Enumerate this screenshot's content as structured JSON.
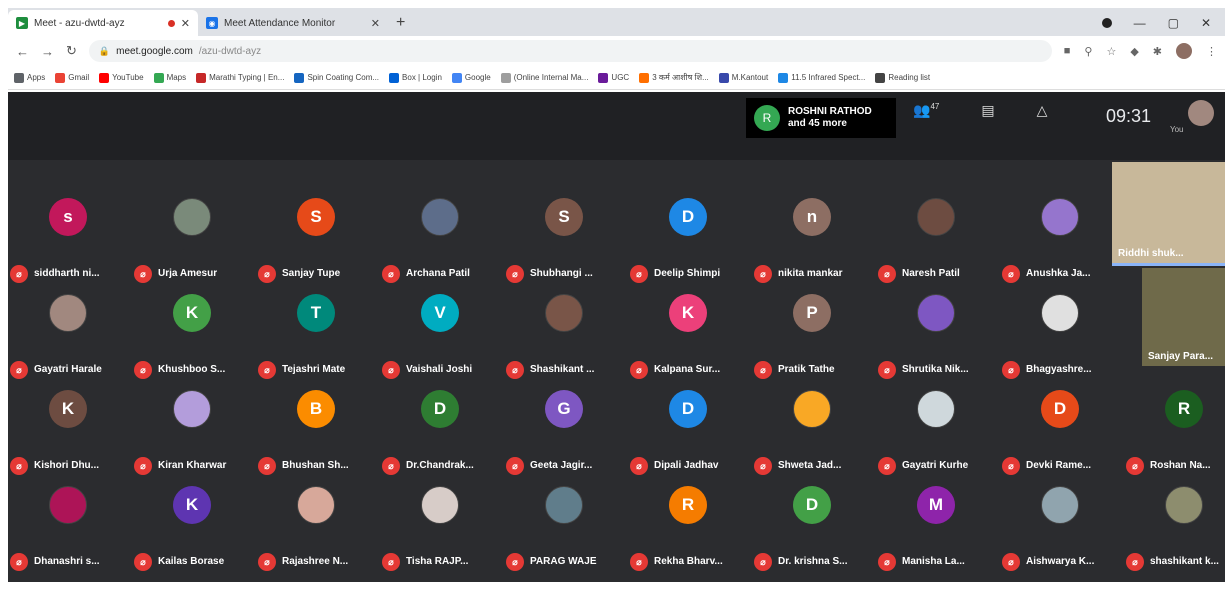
{
  "browser": {
    "tabs": [
      {
        "title": "Meet - azu-dwtd-ayz",
        "fav_color": "#1e8e3e",
        "active": true,
        "recording": true
      },
      {
        "title": "Meet Attendance Monitor",
        "fav_color": "#1a73e8",
        "active": false,
        "recording": false
      }
    ],
    "new_tab": "+",
    "url_host": "meet.google.com",
    "url_path": "/azu-dwtd-ayz",
    "bookmarks": [
      {
        "label": "Apps",
        "color": "#5f6368"
      },
      {
        "label": "Gmail",
        "color": "#ea4335"
      },
      {
        "label": "YouTube",
        "color": "#ff0000"
      },
      {
        "label": "Maps",
        "color": "#34a853"
      },
      {
        "label": "Marathi Typing | En...",
        "color": "#c62828"
      },
      {
        "label": "Spin Coating Com...",
        "color": "#1565c0"
      },
      {
        "label": "Box | Login",
        "color": "#0061d5"
      },
      {
        "label": "Google",
        "color": "#4285f4"
      },
      {
        "label": "(Online Internal Ma...",
        "color": "#9e9e9e"
      },
      {
        "label": "UGC",
        "color": "#6a1b9a"
      },
      {
        "label": "3 कर्म आशीष शि...",
        "color": "#ff6f00"
      },
      {
        "label": "M.Kantout",
        "color": "#3949ab"
      },
      {
        "label": "11.5 Infrared Spect...",
        "color": "#1e88e5"
      },
      {
        "label": "Reading list",
        "color": "#444"
      }
    ]
  },
  "meet": {
    "joined": {
      "initial": "R",
      "name": "ROSHNI RATHOD",
      "more": "and 45 more"
    },
    "participant_count": "47",
    "time": "09:31",
    "self_label": "You",
    "tiles": [
      {
        "name": "siddharth ni...",
        "initial": "s",
        "color": "#c2185b"
      },
      {
        "name": "Urja Amesur",
        "initial": "",
        "color": "#7a8a7a",
        "photo": true
      },
      {
        "name": "Sanjay Tupe",
        "initial": "S",
        "color": "#e64a19"
      },
      {
        "name": "Archana Patil",
        "initial": "",
        "color": "#5d6d8a",
        "photo": true
      },
      {
        "name": "Shubhangi ...",
        "initial": "S",
        "color": "#795548"
      },
      {
        "name": "Deelip Shimpi",
        "initial": "D",
        "color": "#1e88e5"
      },
      {
        "name": "nikita mankar",
        "initial": "n",
        "color": "#8d6e63"
      },
      {
        "name": "Naresh Patil",
        "initial": "",
        "color": "#6d4c41",
        "photo": true
      },
      {
        "name": "Anushka Ja...",
        "initial": "",
        "color": "#9575cd",
        "photo": true
      },
      {
        "name": "Gayatri Harale",
        "initial": "",
        "color": "#a1887f",
        "photo": true
      },
      {
        "name": "Khushboo S...",
        "initial": "K",
        "color": "#43a047"
      },
      {
        "name": "Tejashri Mate",
        "initial": "T",
        "color": "#00897b"
      },
      {
        "name": "Vaishali Joshi",
        "initial": "V",
        "color": "#00acc1"
      },
      {
        "name": "Shashikant ...",
        "initial": "",
        "color": "#795548",
        "photo": true
      },
      {
        "name": "Kalpana Sur...",
        "initial": "K",
        "color": "#ec407a"
      },
      {
        "name": "Pratik Tathe",
        "initial": "P",
        "color": "#8d6e63"
      },
      {
        "name": "Shrutika Nik...",
        "initial": "",
        "color": "#7e57c2",
        "photo": true
      },
      {
        "name": "Bhagyashre...",
        "initial": "",
        "color": "#e0e0e0",
        "photo": true
      },
      {
        "name": "Kishori Dhu...",
        "initial": "K",
        "color": "#6d4c41"
      },
      {
        "name": "Kiran Kharwar",
        "initial": "",
        "color": "#b39ddb",
        "photo": true
      },
      {
        "name": "Bhushan Sh...",
        "initial": "B",
        "color": "#fb8c00"
      },
      {
        "name": "Dr.Chandrak...",
        "initial": "D",
        "color": "#2e7d32"
      },
      {
        "name": "Geeta Jagir...",
        "initial": "G",
        "color": "#7e57c2"
      },
      {
        "name": "Dipali Jadhav",
        "initial": "D",
        "color": "#1e88e5"
      },
      {
        "name": "Shweta Jad...",
        "initial": "",
        "color": "#f9a825",
        "photo": true
      },
      {
        "name": "Gayatri Kurhe",
        "initial": "",
        "color": "#cfd8dc",
        "photo": true
      },
      {
        "name": "Devki Rame...",
        "initial": "D",
        "color": "#e64a19"
      },
      {
        "name": "Roshan Na...",
        "initial": "R",
        "color": "#1b5e20"
      },
      {
        "name": "Dhanashri s...",
        "initial": "",
        "color": "#ad1457",
        "photo": true
      },
      {
        "name": "Kailas Borase",
        "initial": "K",
        "color": "#5e35b1"
      },
      {
        "name": "Rajashree N...",
        "initial": "",
        "color": "#d7a89a",
        "photo": true
      },
      {
        "name": "Tisha RAJP...",
        "initial": "",
        "color": "#d7ccc8",
        "photo": true
      },
      {
        "name": "PARAG WAJE",
        "initial": "",
        "color": "#607d8b",
        "photo": true
      },
      {
        "name": "Rekha Bharv...",
        "initial": "R",
        "color": "#f57c00"
      },
      {
        "name": "Dr. krishna S...",
        "initial": "D",
        "color": "#43a047"
      },
      {
        "name": "Manisha La...",
        "initial": "M",
        "color": "#8e24aa"
      },
      {
        "name": "Aishwarya K...",
        "initial": "",
        "color": "#90a4ae",
        "photo": true
      },
      {
        "name": "shashikant k...",
        "initial": "",
        "color": "#8d8d6e",
        "photo": true
      }
    ],
    "videos": [
      {
        "name": "Riddhi shuk...",
        "bg": "#c8b89a"
      },
      {
        "name": "Sanjay Para...",
        "bg": "#6f6a4a"
      }
    ],
    "mic_glyph": "⌀"
  }
}
